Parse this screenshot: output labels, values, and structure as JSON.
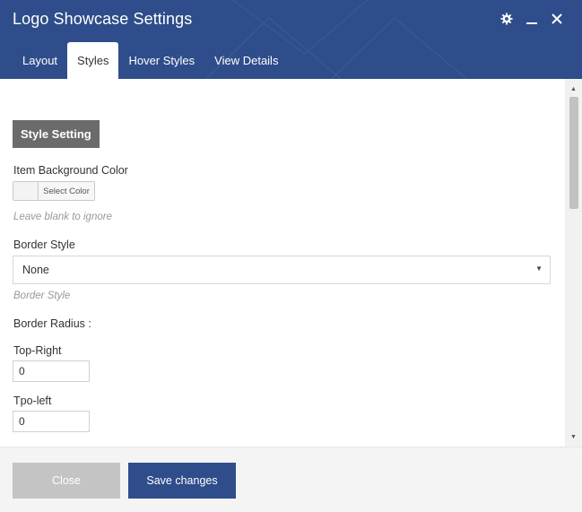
{
  "window": {
    "title": "Logo Showcase Settings",
    "icons": [
      "gear-icon",
      "minimize-icon",
      "close-icon"
    ]
  },
  "tabs": [
    {
      "label": "Layout",
      "active": false
    },
    {
      "label": "Styles",
      "active": true
    },
    {
      "label": "Hover Styles",
      "active": false
    },
    {
      "label": "View Details",
      "active": false
    }
  ],
  "content": {
    "section_heading": "Style Setting",
    "item_bg": {
      "label": "Item Background Color",
      "button_label": "Select Color",
      "hint": "Leave blank to ignore"
    },
    "border_style": {
      "label": "Border Style",
      "selected": "None",
      "hint": "Border Style"
    },
    "border_radius": {
      "label": "Border Radius :",
      "top_right": {
        "label": "Top-Right",
        "value": "0"
      },
      "top_left": {
        "label": "Tpo-left",
        "value": "0"
      }
    }
  },
  "footer": {
    "close_label": "Close",
    "save_label": "Save changes"
  },
  "colors": {
    "header_bg": "#2e4d8a",
    "primary_button": "#2e4d8a",
    "disabled_button": "#c4c4c4",
    "section_heading_bg": "#6b6b6b"
  }
}
